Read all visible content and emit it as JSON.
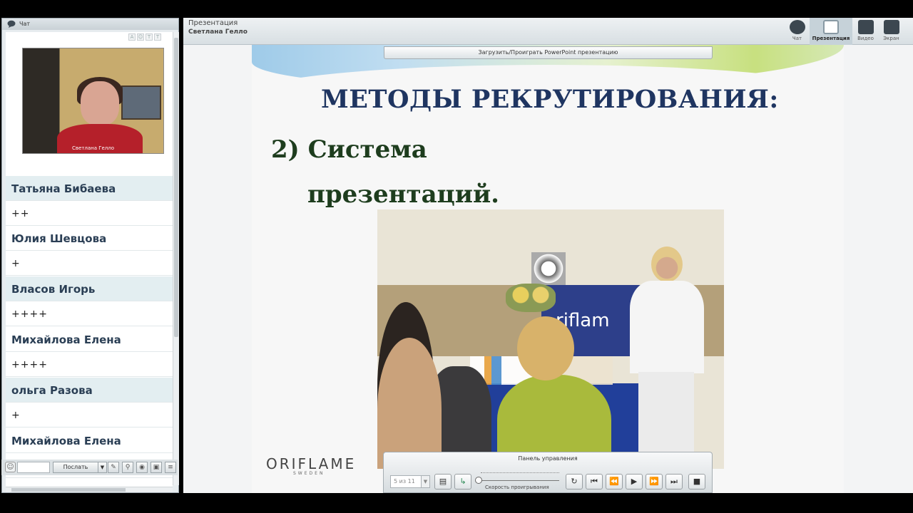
{
  "chat": {
    "header_label": "Чат",
    "video_name": "Светлана Гелло",
    "rows": [
      {
        "type": "name",
        "text": "Татьяна Бибаева"
      },
      {
        "type": "msg",
        "text": "++"
      },
      {
        "type": "name",
        "text": "Юлия Шевцова"
      },
      {
        "type": "msg",
        "text": "+"
      },
      {
        "type": "name",
        "text": "Власов Игорь"
      },
      {
        "type": "msg",
        "text": "++++"
      },
      {
        "type": "name",
        "text": "Михайлова Елена"
      },
      {
        "type": "msg",
        "text": "++++"
      },
      {
        "type": "name",
        "text": "ольга Разова"
      },
      {
        "type": "msg",
        "text": "+"
      },
      {
        "type": "name",
        "text": "Михайлова Елена"
      },
      {
        "type": "msg",
        "text": "++"
      }
    ],
    "send_label": "Послать"
  },
  "presentation": {
    "title": "Презентация",
    "user": "Светлана Гелло",
    "modes": [
      "Чат",
      "Презентация",
      "Видео",
      "Экран"
    ],
    "upload_label": "Загрузить/Проиграть PowerPoint презентацию"
  },
  "slide": {
    "heading": "МЕТОДЫ РЕКРУТИРОВАНИЯ:",
    "sub1": "2) Система",
    "sub2": "презентаций.",
    "banner_text": "riflam",
    "logo": "ORIFLAME",
    "logo_sub": "SWEDEN"
  },
  "controls": {
    "title": "Панель управления",
    "page": "5 из 11",
    "speed_label": "Скорость проигрывания"
  }
}
